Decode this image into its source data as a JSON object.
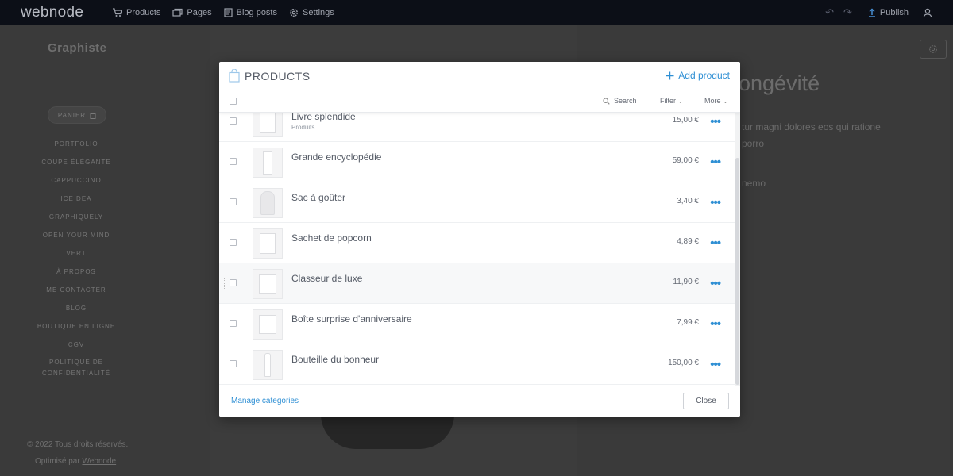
{
  "topbar": {
    "logo": "webnode",
    "nav": [
      {
        "label": "Products",
        "icon": "cart-icon"
      },
      {
        "label": "Pages",
        "icon": "pages-icon"
      },
      {
        "label": "Blog posts",
        "icon": "blog-icon"
      },
      {
        "label": "Settings",
        "icon": "gear-icon"
      }
    ],
    "undo_glyph": "↶",
    "redo_glyph": "↷",
    "publish_label": "Publish"
  },
  "site": {
    "title": "Graphiste",
    "cart_label": "PANIER",
    "menu": [
      "PORTFOLIO",
      "COUPE ÉLÉGANTE",
      "CAPPUCCINO",
      "ICE DEA",
      "GRAPHIQUELY",
      "OPEN YOUR MIND",
      "VERT",
      "À PROPOS",
      "ME CONTACTER",
      "BLOG",
      "BOUTIQUE EN LIGNE",
      "CGV",
      "POLITIQUE DE CONFIDENTIALITÉ"
    ],
    "footer_copyright": "© 2022 Tous droits réservés.",
    "footer_powered_prefix": "Optimisé par ",
    "footer_powered_link": "Webnode",
    "heading_fragment": "ongévité",
    "paragraph_fragments": [
      "tur magni dolores eos qui ratione",
      "porro",
      "nemo"
    ]
  },
  "modal": {
    "title": "PRODUCTS",
    "add_label": "Add product",
    "toolbar": {
      "search_label": "Search",
      "filter_label": "Filter",
      "more_label": "More",
      "caret": "⌄"
    },
    "products": [
      {
        "name": "Livre splendide",
        "category": "Produits",
        "price": "15,00 €"
      },
      {
        "name": "Grande encyclopédie",
        "category": "",
        "price": "59,00 €"
      },
      {
        "name": "Sac à goûter",
        "category": "",
        "price": "3,40 €"
      },
      {
        "name": "Sachet de popcorn",
        "category": "",
        "price": "4,89 €"
      },
      {
        "name": "Classeur de luxe",
        "category": "",
        "price": "11,90 €"
      },
      {
        "name": "Boîte surprise d'anniversaire",
        "category": "",
        "price": "7,99 €"
      },
      {
        "name": "Bouteille du bonheur",
        "category": "",
        "price": "150,00 €"
      }
    ],
    "row_menu_glyph": "•••",
    "manage_categories_label": "Manage categories",
    "close_label": "Close"
  },
  "colors": {
    "accent": "#2e8fd4",
    "topbar": "#0c0f17",
    "overlay": "#3a3a3a"
  }
}
